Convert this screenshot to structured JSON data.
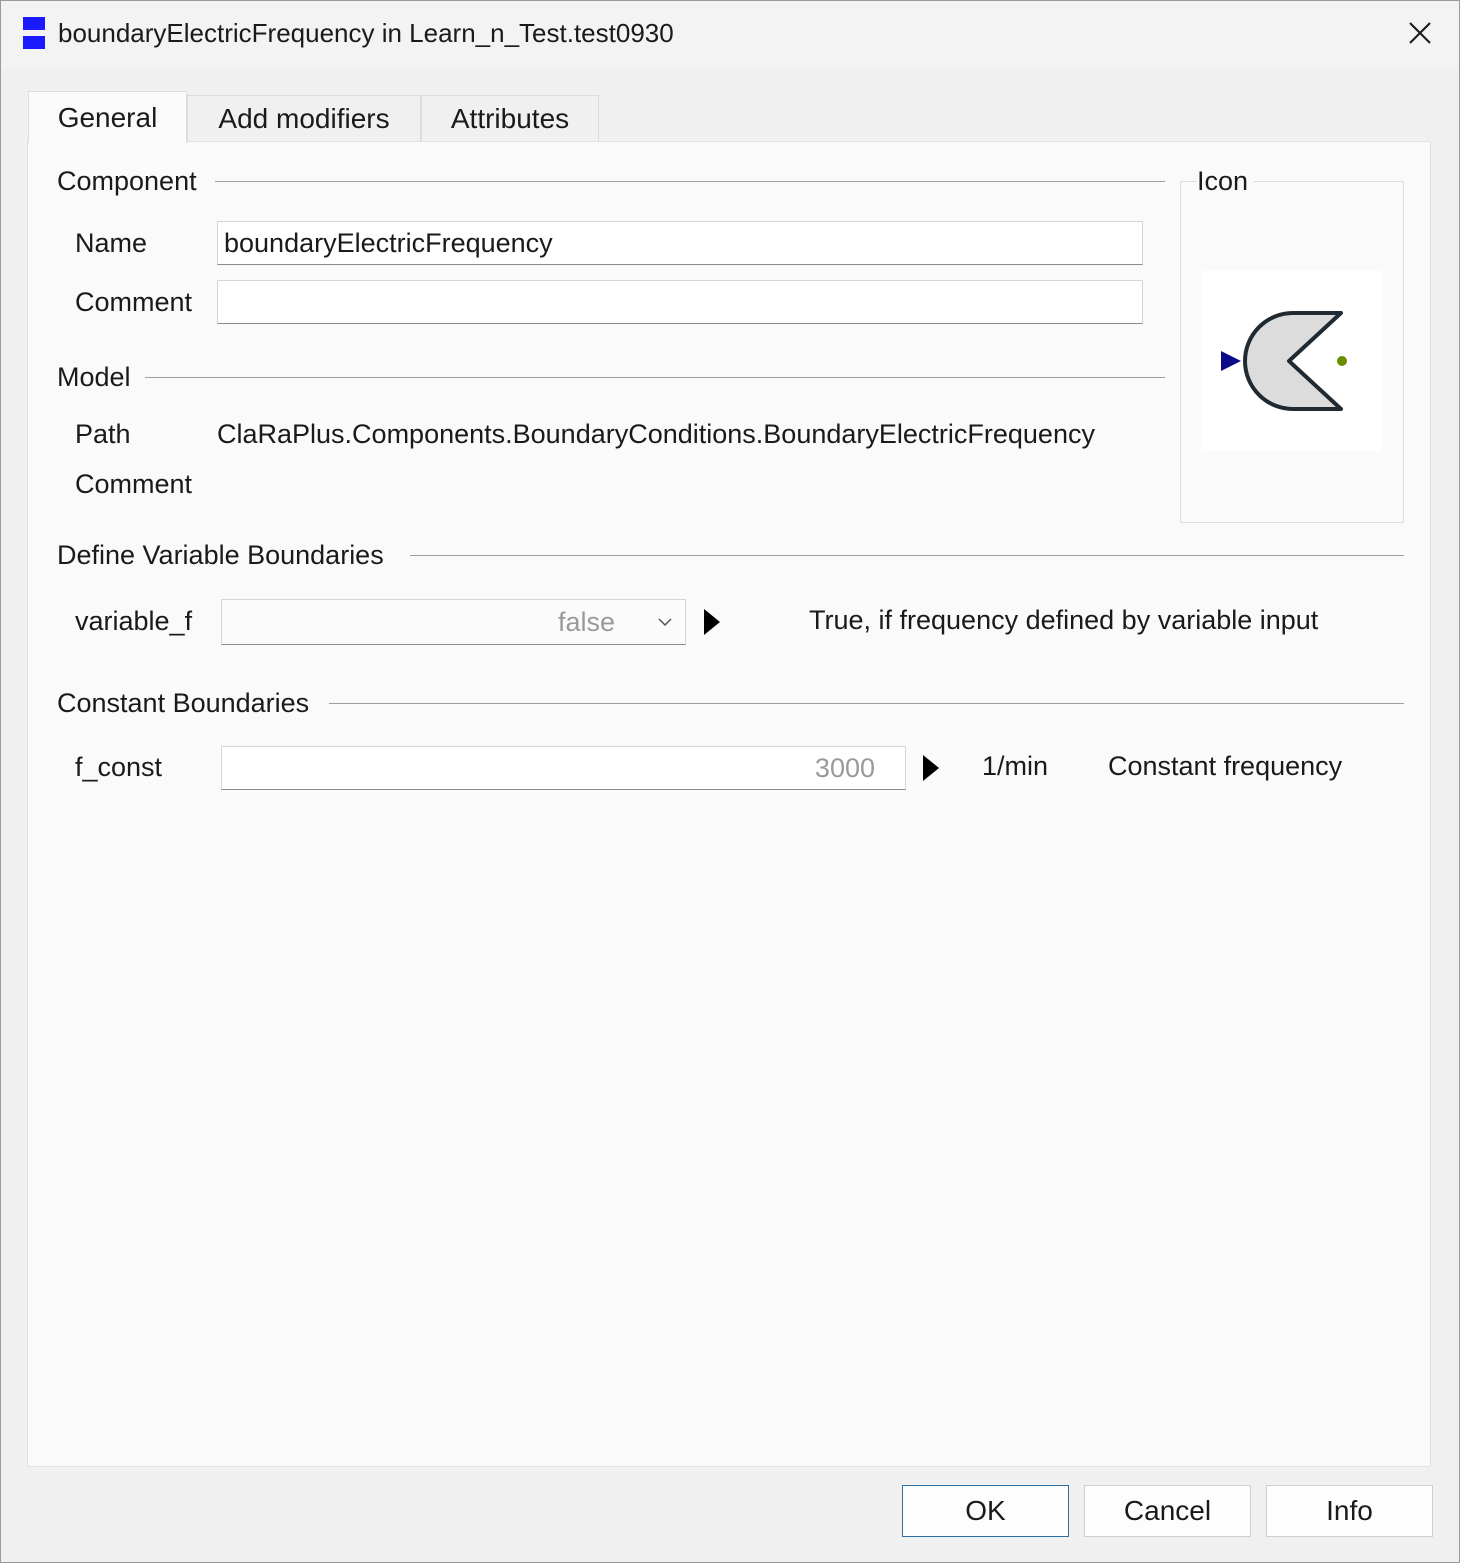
{
  "window": {
    "title": "boundaryElectricFrequency in Learn_n_Test.test0930"
  },
  "tabs": [
    {
      "label": "General",
      "active": true
    },
    {
      "label": "Add modifiers",
      "active": false
    },
    {
      "label": "Attributes",
      "active": false
    }
  ],
  "component": {
    "group_title": "Component",
    "name_label": "Name",
    "name_value": "boundaryElectricFrequency",
    "comment_label": "Comment",
    "comment_value": ""
  },
  "model": {
    "group_title": "Model",
    "path_label": "Path",
    "path_value": "ClaRaPlus.Components.BoundaryConditions.BoundaryElectricFrequency",
    "comment_label": "Comment",
    "comment_value": ""
  },
  "icon_panel": {
    "title": "Icon",
    "icon_name": "boundary-electric-frequency-icon",
    "colors": {
      "input_triangle": "#0b0b8a",
      "body_fill": "#dcdcdc",
      "body_stroke": "#1f2a33",
      "dot": "#6b8e00"
    }
  },
  "variable_boundaries": {
    "group_title": "Define Variable Boundaries",
    "param_label": "variable_f",
    "selected_value": "false",
    "description": "True, if frequency defined by variable input"
  },
  "constant_boundaries": {
    "group_title": "Constant Boundaries",
    "param_label": "f_const",
    "value_placeholder": "3000",
    "unit": "1/min",
    "description": "Constant frequency"
  },
  "buttons": {
    "ok": "OK",
    "cancel": "Cancel",
    "info": "Info"
  }
}
